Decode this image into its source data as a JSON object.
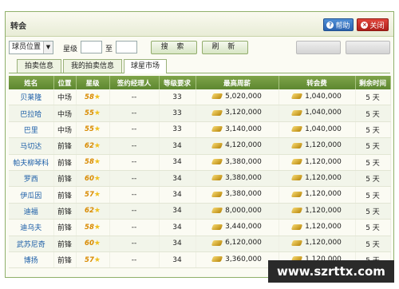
{
  "window": {
    "title": "转会",
    "help_label": "帮助",
    "close_label": "关闭"
  },
  "filter": {
    "position_select": "球员位置",
    "star_label": "星级",
    "to_label": "至",
    "search_label": "搜 索",
    "refresh_label": "刷 新"
  },
  "tabs": [
    {
      "label": "拍卖信息"
    },
    {
      "label": "我的拍卖信息"
    },
    {
      "label": "球星市场"
    }
  ],
  "table": {
    "headers": [
      "姓名",
      "位置",
      "星级",
      "签约经理人",
      "等级要求",
      "最高周薪",
      "转会费",
      "剩余时间"
    ],
    "rows": [
      {
        "name": "贝莱隆",
        "pos": "中场",
        "star": "58",
        "agent": "--",
        "level": "33",
        "salary": "5,020,000",
        "fee": "1,040,000",
        "time": "5 天"
      },
      {
        "name": "巴拉哈",
        "pos": "中场",
        "star": "55",
        "agent": "--",
        "level": "33",
        "salary": "3,120,000",
        "fee": "1,040,000",
        "time": "5 天"
      },
      {
        "name": "巴里",
        "pos": "中场",
        "star": "55",
        "agent": "--",
        "level": "33",
        "salary": "3,140,000",
        "fee": "1,040,000",
        "time": "5 天"
      },
      {
        "name": "马切达",
        "pos": "前锋",
        "star": "62",
        "agent": "--",
        "level": "34",
        "salary": "4,120,000",
        "fee": "1,120,000",
        "time": "5 天"
      },
      {
        "name": "帕夫柳琴科",
        "pos": "前锋",
        "star": "58",
        "agent": "--",
        "level": "34",
        "salary": "3,380,000",
        "fee": "1,120,000",
        "time": "5 天"
      },
      {
        "name": "罗西",
        "pos": "前锋",
        "star": "60",
        "agent": "--",
        "level": "34",
        "salary": "3,380,000",
        "fee": "1,120,000",
        "time": "5 天"
      },
      {
        "name": "伊瓜因",
        "pos": "前锋",
        "star": "57",
        "agent": "--",
        "level": "34",
        "salary": "3,380,000",
        "fee": "1,120,000",
        "time": "5 天"
      },
      {
        "name": "迪福",
        "pos": "前锋",
        "star": "62",
        "agent": "--",
        "level": "34",
        "salary": "8,000,000",
        "fee": "1,120,000",
        "time": "5 天"
      },
      {
        "name": "迪乌夫",
        "pos": "前锋",
        "star": "58",
        "agent": "--",
        "level": "34",
        "salary": "3,440,000",
        "fee": "1,120,000",
        "time": "5 天"
      },
      {
        "name": "武苏尼奇",
        "pos": "前锋",
        "star": "60",
        "agent": "--",
        "level": "34",
        "salary": "6,120,000",
        "fee": "1,120,000",
        "time": "5 天"
      },
      {
        "name": "博扬",
        "pos": "前锋",
        "star": "57",
        "agent": "--",
        "level": "34",
        "salary": "3,360,000",
        "fee": "1,120,000",
        "time": "5 天"
      }
    ]
  },
  "watermark": "www.szrttx.com"
}
